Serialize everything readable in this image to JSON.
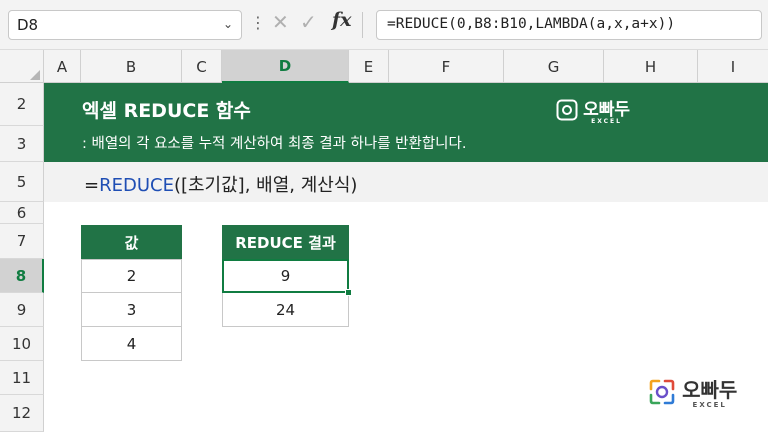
{
  "formula_bar": {
    "name_box": "D8",
    "formula": "=REDUCE(0,B8:B10,LAMBDA(a,x,a+x))",
    "fx_label": "fx"
  },
  "columns": [
    "A",
    "B",
    "C",
    "D",
    "E",
    "F",
    "G",
    "H",
    "I"
  ],
  "rows": [
    "2",
    "3",
    "5",
    "6",
    "7",
    "8",
    "9",
    "10",
    "11",
    "12"
  ],
  "banner": {
    "title": "엑셀 REDUCE 함수",
    "subtitle": ": 배열의 각 요소를 누적 계산하여 최종 결과 하나를 반환합니다.",
    "logo_text": "오빠두",
    "logo_sub": "EXCEL"
  },
  "syntax": {
    "prefix": "=",
    "function": "REDUCE",
    "args": "([초기값], 배열, 계산식)"
  },
  "value_table": {
    "header": "값",
    "values": [
      "2",
      "3",
      "4"
    ]
  },
  "result_table": {
    "header": "REDUCE 결과",
    "values": [
      "9",
      "24"
    ]
  },
  "bottom_logo": {
    "text": "오빠두",
    "sub": "EXCEL"
  },
  "colors": {
    "excel_green": "#217346",
    "selection_green": "#107c41",
    "function_blue": "#1f4eb4"
  }
}
